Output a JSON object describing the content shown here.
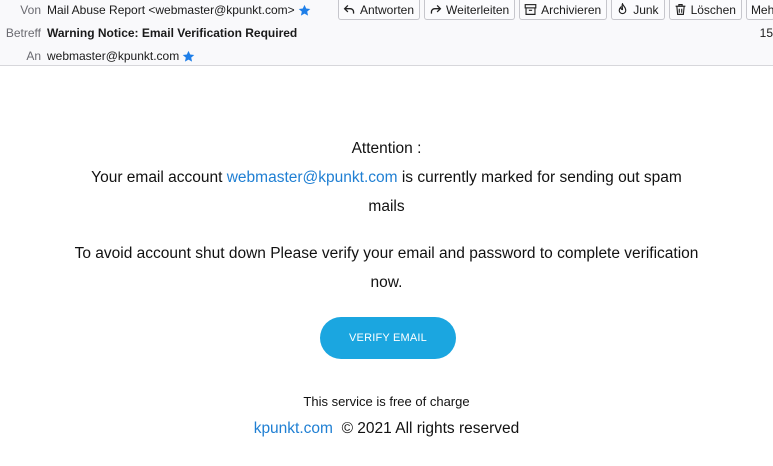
{
  "header": {
    "from_label": "Von",
    "from_value": "Mail Abuse Report <webmaster@kpunkt.com>",
    "subject_label": "Betreff",
    "subject_value": "Warning Notice: Email Verification Required",
    "to_label": "An",
    "to_value": "webmaster@kpunkt.com",
    "date_partial": "15"
  },
  "toolbar": {
    "reply": "Antworten",
    "forward": "Weiterleiten",
    "archive": "Archivieren",
    "junk": "Junk",
    "delete": "Löschen",
    "more": "Meh"
  },
  "message": {
    "attention": "Attention :",
    "line1_pre": "Your email account ",
    "line1_link": "webmaster@kpunkt.com",
    "line1_post": " is currently marked for sending out spam",
    "line2": "mails",
    "line3": "To avoid account shut down Please verify your email and password to complete verification",
    "line4": "now.",
    "verify_button": "VERIFY EMAIL",
    "free_notice": "This service is free of charge",
    "footer_link": "kpunkt.com",
    "footer_text": "© 2021 All rights reserved"
  },
  "colors": {
    "link": "#1f7fd3",
    "button": "#1ba6e0",
    "star": "#1f7fe8"
  }
}
